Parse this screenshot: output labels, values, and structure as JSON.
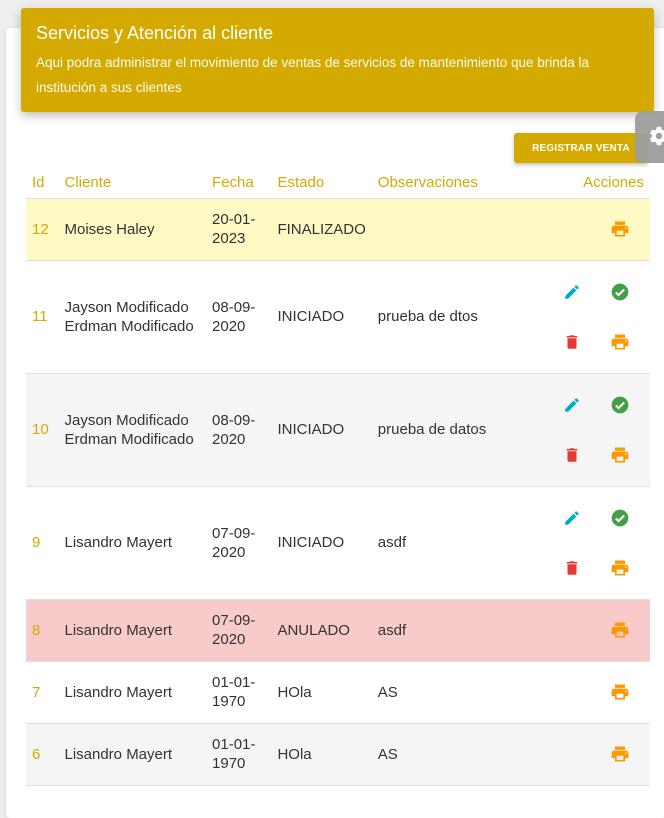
{
  "header": {
    "title": "Servicios y Atención al cliente",
    "subtitle": "Aqui podra administrar el movimiento de ventas de servicios de mantenimiento que brinda la institución a sus clientes"
  },
  "toolbar": {
    "register_label": "REGISTRAR VENTA"
  },
  "table": {
    "columns": [
      "Id",
      "Cliente",
      "Fecha",
      "Estado",
      "Observaciones",
      "Acciones"
    ],
    "rows": [
      {
        "id": "12",
        "cliente": "Moises Haley",
        "fecha": "20-01-2023",
        "estado": "FINALIZADO",
        "obs": ""
      },
      {
        "id": "11",
        "cliente": "Jayson Modificado Erdman Modificado",
        "fecha": "08-09-2020",
        "estado": "INICIADO",
        "obs": "prueba de dtos"
      },
      {
        "id": "10",
        "cliente": "Jayson Modificado Erdman Modificado",
        "fecha": "08-09-2020",
        "estado": "INICIADO",
        "obs": "prueba de datos"
      },
      {
        "id": "9",
        "cliente": "Lisandro Mayert",
        "fecha": "07-09-2020",
        "estado": "INICIADO",
        "obs": "asdf"
      },
      {
        "id": "8",
        "cliente": "Lisandro Mayert",
        "fecha": "07-09-2020",
        "estado": "ANULADO",
        "obs": "asdf"
      },
      {
        "id": "7",
        "cliente": "Lisandro Mayert",
        "fecha": "01-01-1970",
        "estado": "HOla",
        "obs": "AS"
      },
      {
        "id": "6",
        "cliente": "Lisandro Mayert",
        "fecha": "01-01-1970",
        "estado": "HOla",
        "obs": "AS"
      }
    ]
  },
  "colors": {
    "accent": "#d4aa00",
    "edit": "#00acc1",
    "confirm": "#43a047",
    "delete": "#e53935",
    "print": "#ff9800",
    "row_finalizado": "#fff9c4",
    "row_anulado": "#f8cac9"
  },
  "icons": [
    "pencil-icon",
    "check-circle-icon",
    "trash-icon",
    "printer-icon",
    "gear-icon"
  ]
}
